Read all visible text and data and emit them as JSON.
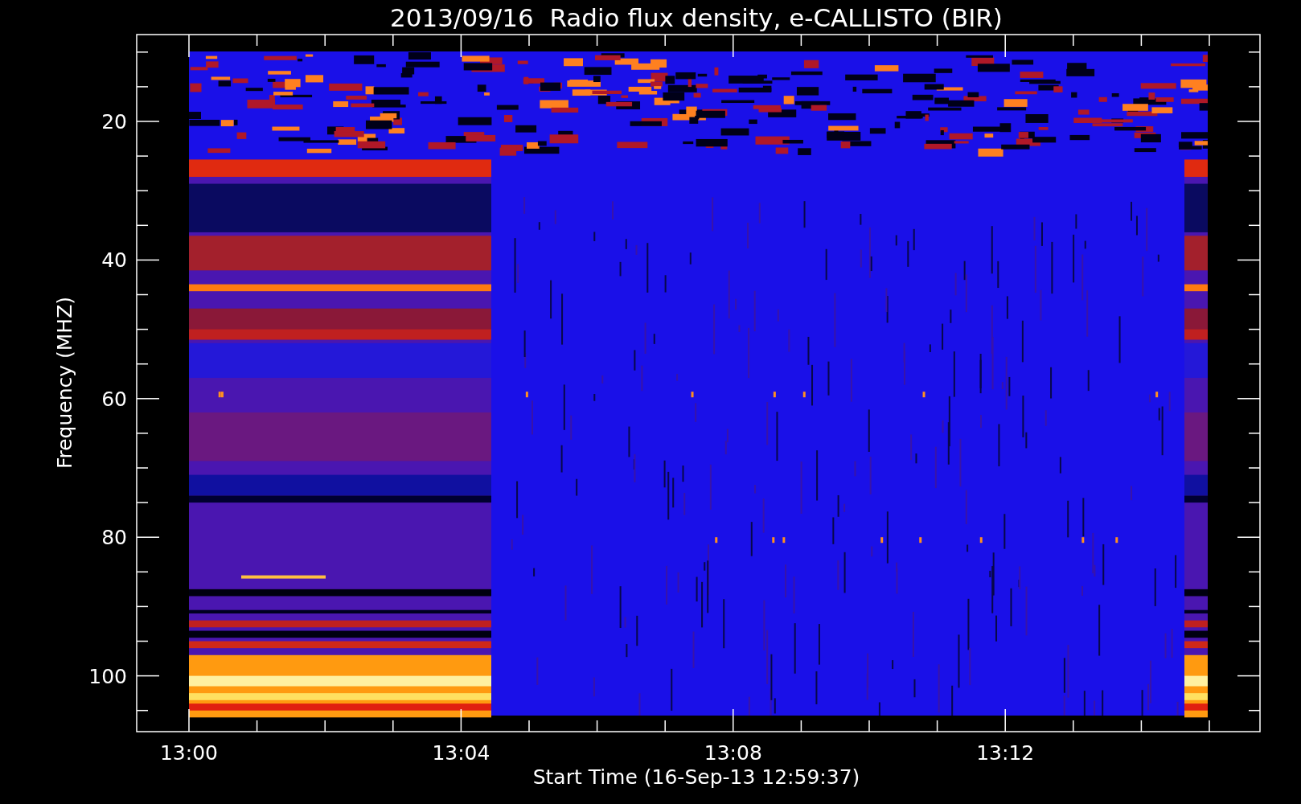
{
  "title": "2013/09/16  Radio flux density, e-CALLISTO (BIR)",
  "y_axis": {
    "label": "Frequency (MHZ)",
    "ticks": [
      "20",
      "40",
      "60",
      "80",
      "100"
    ]
  },
  "x_axis": {
    "label": "Start Time (16-Sep-13 12:59:37)",
    "ticks": [
      "13:00",
      "13:04",
      "13:08",
      "13:12"
    ]
  }
}
